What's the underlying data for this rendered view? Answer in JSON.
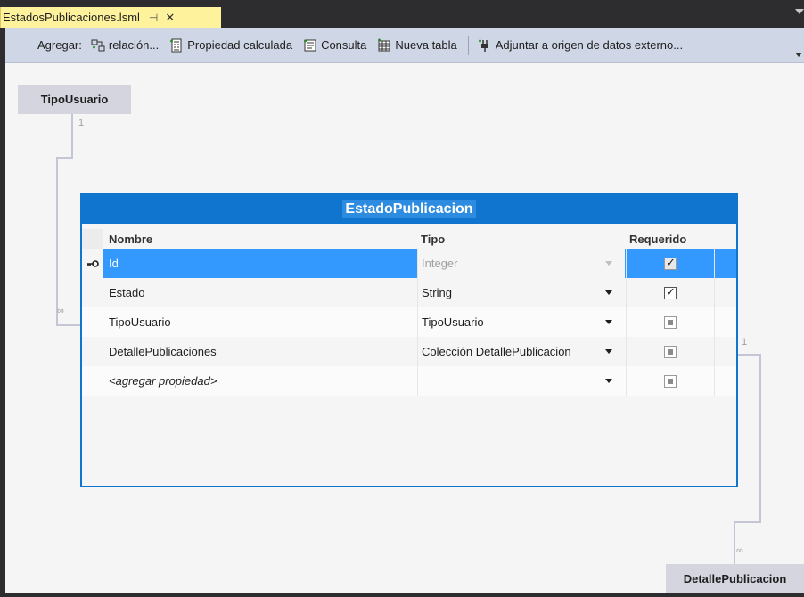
{
  "tab": {
    "title": "EstadosPublicaciones.lsml",
    "pin": "⊣",
    "close": "✕"
  },
  "toolbar": {
    "add_label": "Agregar:",
    "buttons": [
      {
        "label": "relación...",
        "icon": "relation-icon"
      },
      {
        "label": "Propiedad calculada",
        "icon": "computed-property-icon"
      },
      {
        "label": "Consulta",
        "icon": "query-icon"
      },
      {
        "label": "Nueva tabla",
        "icon": "new-table-icon"
      },
      {
        "label": "Adjuntar a origen de datos externo...",
        "icon": "attach-datasource-icon"
      }
    ]
  },
  "diagram": {
    "top_entity": "TipoUsuario",
    "bottom_entity": "DetallePublicacion",
    "top_multiplicity_one": "1",
    "top_multiplicity_many": "∞",
    "bottom_multiplicity_one": "1",
    "bottom_multiplicity_many": "∞"
  },
  "entity": {
    "title": "EstadoPublicacion",
    "headers": {
      "name": "Nombre",
      "type": "Tipo",
      "required": "Requerido"
    },
    "rows": [
      {
        "name": "Id",
        "type": "Integer",
        "required": "checked-disabled",
        "key": true,
        "selected": true
      },
      {
        "name": "Estado",
        "type": "String",
        "required": "checked"
      },
      {
        "name": "TipoUsuario",
        "type": "TipoUsuario",
        "required": "indeterminate"
      },
      {
        "name": "DetallePublicaciones",
        "type": "Colección DetallePublicacion",
        "required": "indeterminate"
      },
      {
        "name": "<agregar propiedad>",
        "type": "",
        "required": "indeterminate",
        "placeholder": true
      }
    ]
  },
  "colors": {
    "accent": "#0f75cf",
    "tab": "#fff29d",
    "toolbar": "#cfd6e5",
    "canvas": "#f5f5f5",
    "selected_row": "#3399ff"
  }
}
